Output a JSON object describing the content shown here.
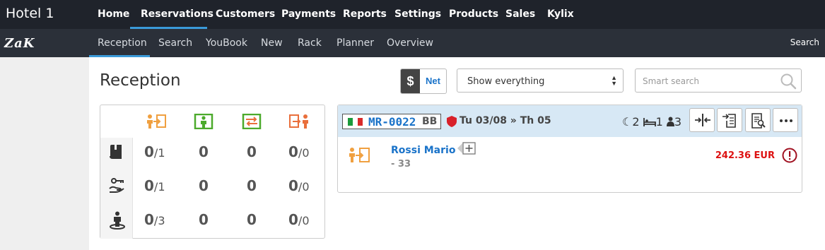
{
  "app": {
    "hotel_name": "Hotel 1",
    "logo_text": "ZaK"
  },
  "topnav": {
    "items": [
      {
        "label": "Home"
      },
      {
        "label": "Reservations"
      },
      {
        "label": "Customers"
      },
      {
        "label": "Payments"
      },
      {
        "label": "Reports"
      },
      {
        "label": "Settings"
      },
      {
        "label": "Products"
      },
      {
        "label": "Sales"
      },
      {
        "label": "Kylix"
      }
    ],
    "active": "Reservations"
  },
  "subnav": {
    "items": [
      {
        "label": "Reception"
      },
      {
        "label": "Search"
      },
      {
        "label": "YouBook"
      },
      {
        "label": "New"
      },
      {
        "label": "Rack"
      },
      {
        "label": "Planner"
      },
      {
        "label": "Overview"
      }
    ],
    "active": "Reception",
    "search_label": "Search"
  },
  "page": {
    "title": "Reception"
  },
  "controls": {
    "currency_symbol": "$",
    "net_label": "Net",
    "filter_selected": "Show everything",
    "smart_search_placeholder": "Smart search"
  },
  "stats": {
    "columns": [
      {
        "icon": "arrival-icon",
        "color": "#f0a040"
      },
      {
        "icon": "in-house-icon",
        "color": "#4caa2c"
      },
      {
        "icon": "room-move-icon",
        "color": "#4caa2c"
      },
      {
        "icon": "departure-icon",
        "color": "#e96f3c"
      }
    ],
    "rows": [
      {
        "icon": "book-icon",
        "cells": [
          {
            "v": "0",
            "d": "/1"
          },
          {
            "v": "0",
            "d": ""
          },
          {
            "v": "0",
            "d": ""
          },
          {
            "v": "0",
            "d": "/0"
          }
        ]
      },
      {
        "icon": "key-hand-icon",
        "cells": [
          {
            "v": "0",
            "d": "/1"
          },
          {
            "v": "0",
            "d": ""
          },
          {
            "v": "0",
            "d": ""
          },
          {
            "v": "0",
            "d": "/0"
          }
        ]
      },
      {
        "icon": "person-standing-icon",
        "cells": [
          {
            "v": "0",
            "d": "/3"
          },
          {
            "v": "0",
            "d": ""
          },
          {
            "v": "0",
            "d": ""
          },
          {
            "v": "0",
            "d": "/0"
          }
        ]
      }
    ]
  },
  "reservation": {
    "code": "MR-0022",
    "board": "BB",
    "dates": "Tu 03/08 » Th 05",
    "nights": "2",
    "rooms": "1",
    "guests": "3",
    "guest_name": "Rossi Mario",
    "guest_sub": "- 33",
    "amount": "242.36 EUR",
    "colors": {
      "amount": "#dd1111",
      "link": "#1a73c9",
      "shield": "#d8202a"
    }
  }
}
